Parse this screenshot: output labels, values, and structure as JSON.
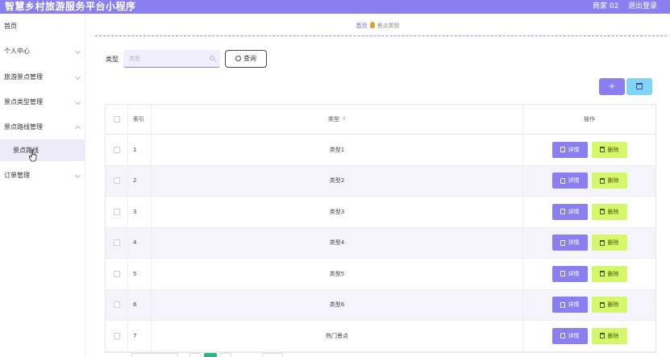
{
  "header": {
    "app_title": "智慧乡村旅游服务平台小程序",
    "user_label": "商家 02",
    "logout_label": "退出登录",
    "bg_color": "#8a7ef0"
  },
  "sidebar": {
    "items": [
      {
        "label": "首页",
        "has_chevron": false
      },
      {
        "label": "个人中心",
        "has_chevron": true
      },
      {
        "label": "旅游景点管理",
        "has_chevron": true
      },
      {
        "label": "景点类型管理",
        "has_chevron": true
      },
      {
        "label": "景点路线管理",
        "has_chevron": true,
        "expanded": true
      },
      {
        "label": "景点路线",
        "is_sub": true,
        "active": true
      },
      {
        "label": "订单管理",
        "has_chevron": true
      }
    ]
  },
  "breadcrumb": {
    "home": "首页",
    "current": "景点类型"
  },
  "search": {
    "label": "类型",
    "placeholder": "类型",
    "button_label": "查询"
  },
  "toolbar": {
    "add_label": "+",
    "add_color": "#8a7ef0",
    "batch_delete_color": "#7fd5f7"
  },
  "table": {
    "columns": [
      "索引",
      "类型",
      "操作"
    ],
    "rows": [
      {
        "index": "1",
        "type": "类型1"
      },
      {
        "index": "2",
        "type": "类型2"
      },
      {
        "index": "3",
        "type": "类型3"
      },
      {
        "index": "4",
        "type": "类型4"
      },
      {
        "index": "5",
        "type": "类型5"
      },
      {
        "index": "6",
        "type": "类型6"
      },
      {
        "index": "7",
        "type": "热门景点"
      }
    ],
    "detail_label": "详情",
    "delete_label": "删除",
    "detail_color": "#8a7ef0",
    "delete_color": "#d5f86a"
  },
  "pagination": {
    "current_color": "#2bb58a"
  }
}
